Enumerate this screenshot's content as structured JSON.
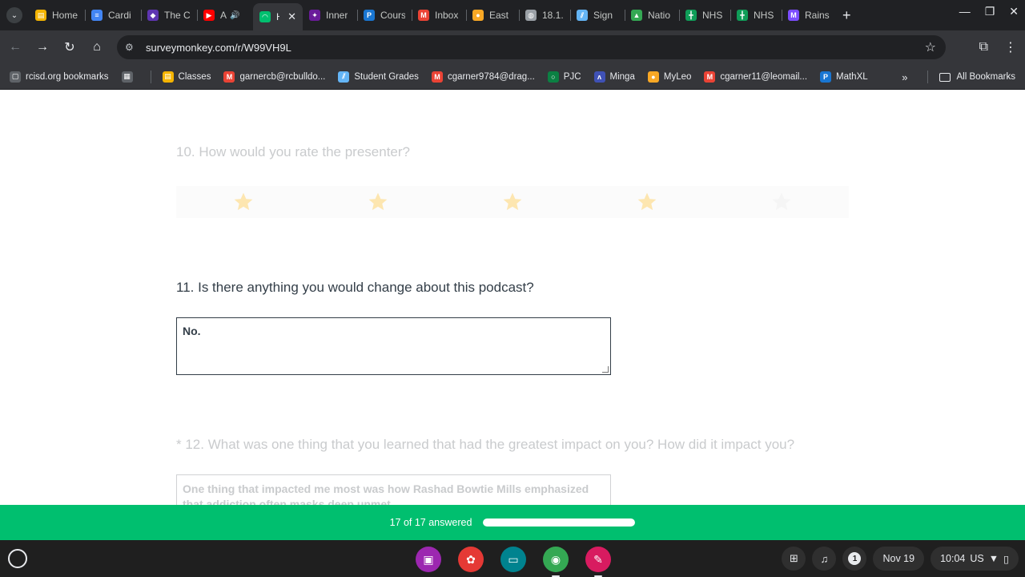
{
  "tabs": [
    {
      "label": "Home",
      "color": "#f4b400",
      "icon": "classroom-icon",
      "glyph": "▤"
    },
    {
      "label": "Cardi",
      "color": "#4285f4",
      "icon": "docs-icon",
      "glyph": "≡"
    },
    {
      "label": "The C",
      "color": "#5e35b1",
      "icon": "shield-icon",
      "glyph": "◆"
    },
    {
      "label": "A",
      "color": "#ff0000",
      "icon": "youtube-icon",
      "glyph": "▶",
      "audio": "🔊"
    },
    {
      "label": "H",
      "color": "#00bf6f",
      "icon": "surveymonkey-icon",
      "glyph": "◠",
      "active": true
    },
    {
      "label": "Inner",
      "color": "#6a1b9a",
      "icon": "inner-icon",
      "glyph": "✦"
    },
    {
      "label": "Cours",
      "color": "#1976d2",
      "icon": "pearson-icon",
      "glyph": "P"
    },
    {
      "label": "Inbox",
      "color": "#ea4335",
      "icon": "gmail-icon",
      "glyph": "M"
    },
    {
      "label": "East",
      "color": "#f9a825",
      "icon": "east-icon",
      "glyph": "●"
    },
    {
      "label": "18.1.",
      "color": "#9aa0a6",
      "icon": "globe-icon",
      "glyph": "◍"
    },
    {
      "label": "Sign",
      "color": "#64b5f6",
      "icon": "stripes-icon",
      "glyph": "⫽"
    },
    {
      "label": "Natio",
      "color": "#34a853",
      "icon": "drive-icon",
      "glyph": "▲"
    },
    {
      "label": "NHS",
      "color": "#0f9d58",
      "icon": "sheets-icon",
      "glyph": "╋"
    },
    {
      "label": "NHS",
      "color": "#0f9d58",
      "icon": "sheets-icon",
      "glyph": "╋"
    },
    {
      "label": "Rains",
      "color": "#7c4dff",
      "icon": "m-icon",
      "glyph": "M"
    }
  ],
  "tab_close": "✕",
  "new_tab": "+",
  "window": {
    "minimize": "—",
    "restore": "❐",
    "close": "✕"
  },
  "address": {
    "url": "surveymonkey.com/r/W99VH9L"
  },
  "bookmarks": [
    {
      "label": "rcisd.org bookmarks",
      "color": "#5f6368",
      "icon": "folder-icon",
      "glyph": "▢"
    },
    {
      "label": "",
      "color": "#5f6368",
      "icon": "apps-grid-icon",
      "glyph": "▦"
    },
    {
      "label": "Classes",
      "color": "#f4b400",
      "icon": "classroom-icon",
      "glyph": "▤"
    },
    {
      "label": "garnercb@rcbulldo...",
      "color": "#ea4335",
      "icon": "gmail-icon",
      "glyph": "M"
    },
    {
      "label": "Student Grades",
      "color": "#64b5f6",
      "icon": "stripes-icon",
      "glyph": "⫽"
    },
    {
      "label": "cgarner9784@drag...",
      "color": "#ea4335",
      "icon": "gmail-icon",
      "glyph": "M"
    },
    {
      "label": "PJC",
      "color": "#0b8043",
      "icon": "pjc-icon",
      "glyph": "○"
    },
    {
      "label": "Minga",
      "color": "#3f51b5",
      "icon": "minga-icon",
      "glyph": "ʌ"
    },
    {
      "label": "MyLeo",
      "color": "#f9a825",
      "icon": "myleo-icon",
      "glyph": "●"
    },
    {
      "label": "cgarner11@leomail...",
      "color": "#ea4335",
      "icon": "gmail-icon",
      "glyph": "M"
    },
    {
      "label": "MathXL",
      "color": "#1976d2",
      "icon": "pearson-icon",
      "glyph": "P"
    }
  ],
  "all_bookmarks": "All Bookmarks",
  "survey": {
    "q10": "10. How would you rate the presenter?",
    "rating": {
      "filled": 4,
      "total": 5,
      "filled_color": "#fde6b0",
      "empty_color": "#f5f5f5"
    },
    "q11": "11. Is there anything you would change about this podcast?",
    "q11_answer": "No.",
    "q12": "* 12. What was one thing that you learned that had the greatest impact on you? How did it impact you?",
    "q12_answer": "One thing that impacted me most was how Rashad Bowtie Mills emphasized that addiction often masks deep unmet"
  },
  "progress": {
    "text": "17 of 17 answered",
    "answered": 17,
    "total": 17,
    "color": "#00bf6f"
  },
  "shelf": {
    "apps": [
      {
        "icon": "classroom-app-icon",
        "color": "#9c27b0",
        "glyph": "▣"
      },
      {
        "icon": "paint-app-icon",
        "color": "#e53935",
        "glyph": "✿"
      },
      {
        "icon": "slides-app-icon",
        "color": "#00838f",
        "glyph": "▭"
      },
      {
        "icon": "chrome-app-icon",
        "color": "#34a853",
        "glyph": "◉",
        "open": true
      },
      {
        "icon": "notes-app-icon",
        "color": "#d81b60",
        "glyph": "✎",
        "open": true
      }
    ],
    "notification_count": "1",
    "date": "Nov 19",
    "time": "10:04",
    "locale": "US"
  }
}
